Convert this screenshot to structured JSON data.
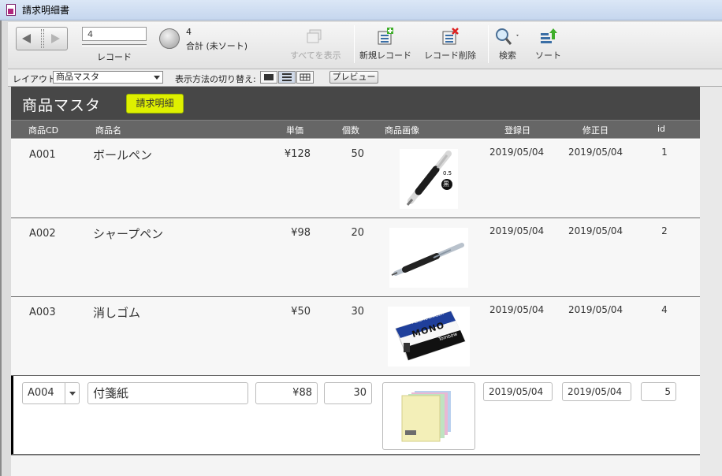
{
  "window": {
    "title": "請求明細書"
  },
  "toolbar": {
    "record_value": "4",
    "record_label": "レコード",
    "found_count": "4",
    "found_total": "合計 (未ソート)",
    "show_all": "すべてを表示",
    "new_record": "新規レコード",
    "delete_record": "レコード削除",
    "find": "検索",
    "sort": "ソート"
  },
  "layoutbar": {
    "layout_label": "レイアウト:",
    "layout_value": "商品マスタ",
    "view_as_label": "表示方法の切り替え:",
    "preview": "プレビュー"
  },
  "header": {
    "title": "商品マスタ",
    "invoice_button": "請求明細"
  },
  "columns": {
    "cd": "商品CD",
    "name": "商品名",
    "price": "単価",
    "qty": "個数",
    "image": "商品画像",
    "created": "登録日",
    "modified": "修正日",
    "id": "id"
  },
  "rows": [
    {
      "cd": "A001",
      "name": "ボールペン",
      "price": "¥128",
      "qty": "50",
      "created": "2019/05/04",
      "modified": "2019/05/04",
      "id": "1",
      "image": "ballpoint-pen-image",
      "badge_size": "0.5",
      "badge_color": "黒"
    },
    {
      "cd": "A002",
      "name": "シャープペン",
      "price": "¥98",
      "qty": "20",
      "created": "2019/05/04",
      "modified": "2019/05/04",
      "id": "2",
      "image": "mechanical-pencil-image"
    },
    {
      "cd": "A003",
      "name": "消しゴム",
      "price": "¥50",
      "qty": "30",
      "created": "2019/05/04",
      "modified": "2019/05/04",
      "id": "4",
      "image": "eraser-image",
      "brand": "MONO",
      "brand_sub": "Tombow",
      "brand_top": "PLASTIC ERASER"
    },
    {
      "cd": "A004",
      "name": "付箋紙",
      "price": "¥88",
      "qty": "30",
      "created": "2019/05/04",
      "modified": "2019/05/04",
      "id": "5",
      "image": "sticky-notes-image"
    }
  ],
  "colors": {
    "header_bg": "#474747",
    "column_bar": "#666666",
    "accent_button": "#dff000"
  }
}
